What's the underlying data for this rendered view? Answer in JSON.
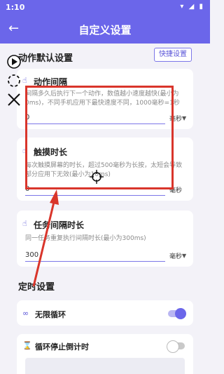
{
  "status": {
    "time": "1:10",
    "icons": "▾ ◢ ▮"
  },
  "appbar": {
    "title": "自定义设置"
  },
  "section_default": {
    "title": "动作默认设置",
    "shortcut": "快捷设置"
  },
  "interval_card": {
    "title": "动作间隔",
    "desc": "间隔多久后执行下一个动作，数值越小速度越快(最小为0ms)，不同手机应用下最快速度不同，1000毫秒=1秒",
    "value": "0",
    "unit": "毫秒"
  },
  "touch_card": {
    "title": "触摸时长",
    "desc": "每次触摸屏幕的时长，超过500毫秒为长按，太短会导致部分应用下无效(最小为10ms)",
    "value": "0",
    "unit": "毫秒"
  },
  "task_card": {
    "title": "任务间隔时长",
    "desc": "同一任务重复执行间隔时长(最小为300ms)",
    "value": "300",
    "unit": "毫秒"
  },
  "section_timer": {
    "title": "定时设置"
  },
  "infinite_loop": {
    "label": "无限循环",
    "on": true
  },
  "loop_stop": {
    "label": "循环停止倒计时",
    "on": false
  },
  "colors": {
    "primary": "#6b66ea",
    "annotation": "#d9352b"
  }
}
